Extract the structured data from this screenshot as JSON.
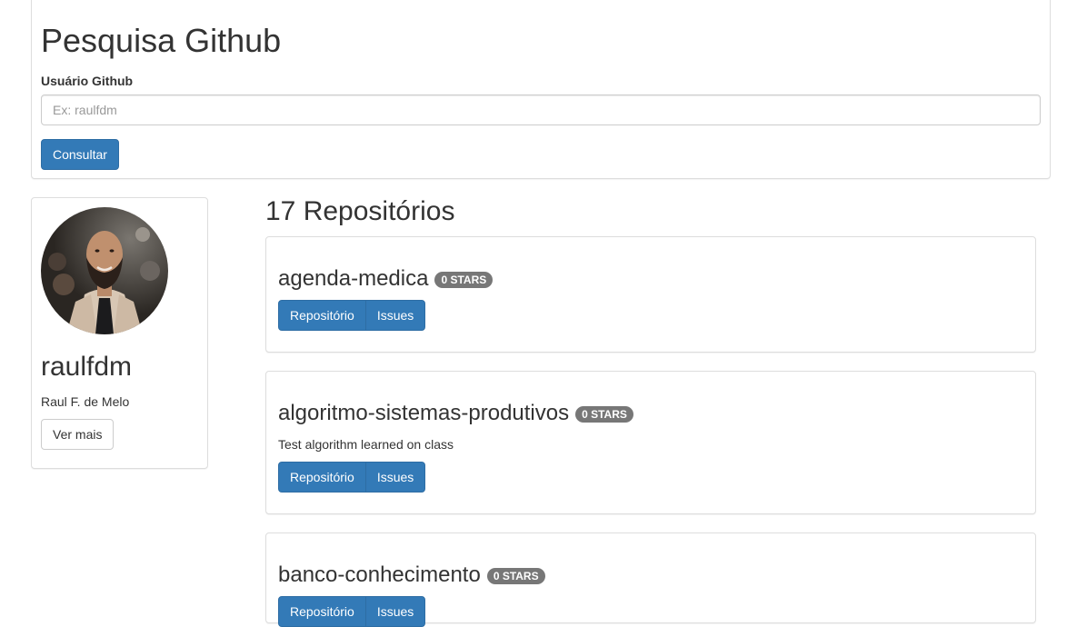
{
  "search": {
    "title": "Pesquisa Github",
    "field_label": "Usuário Github",
    "placeholder": "Ex: raulfdm",
    "value": "",
    "button_label": "Consultar"
  },
  "profile": {
    "username": "raulfdm",
    "full_name": "Raul F. de Melo",
    "more_label": "Ver mais"
  },
  "repos": {
    "heading": "17 Repositórios",
    "items": [
      {
        "name": "agenda-medica",
        "stars": "0 STARS",
        "description": "",
        "repo_label": "Repositório",
        "issues_label": "Issues"
      },
      {
        "name": "algoritmo-sistemas-produtivos",
        "stars": "0 STARS",
        "description": "Test algorithm learned on class",
        "repo_label": "Repositório",
        "issues_label": "Issues"
      },
      {
        "name": "banco-conhecimento",
        "stars": "0 STARS",
        "description": "",
        "repo_label": "Repositório",
        "issues_label": "Issues"
      }
    ]
  },
  "colors": {
    "primary": "#337ab7",
    "badge": "#777777",
    "border": "#dddddd"
  }
}
